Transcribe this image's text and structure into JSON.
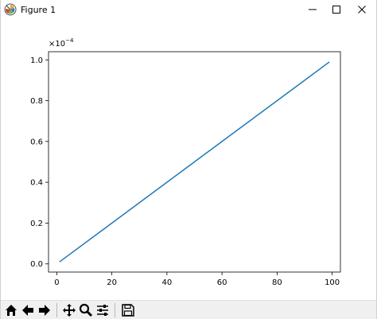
{
  "window": {
    "title": "Figure 1"
  },
  "titlebar_buttons": {
    "minimize_icon": "minimize-icon",
    "maximize_icon": "maximize-icon",
    "close_icon": "close-icon"
  },
  "toolbar": {
    "icons": [
      "home-icon",
      "back-arrow-icon",
      "forward-arrow-icon",
      "pan-icon",
      "zoom-icon",
      "configure-subplots-icon",
      "save-icon"
    ]
  },
  "colors": {
    "line": "#1f77b4",
    "toolbar_bg": "#f0f0f0"
  },
  "chart_data": {
    "type": "line",
    "x": [
      1,
      99
    ],
    "y": [
      0.01,
      0.99
    ],
    "y_offset_label_base": "×10",
    "y_offset_label_exp": "−4",
    "xlim": [
      -3,
      103
    ],
    "ylim": [
      -0.04,
      1.04
    ],
    "xticks": [
      "0",
      "20",
      "40",
      "60",
      "80",
      "100"
    ],
    "xtick_values": [
      0,
      20,
      40,
      60,
      80,
      100
    ],
    "yticks": [
      "0.0",
      "0.2",
      "0.4",
      "0.6",
      "0.8",
      "1.0"
    ],
    "ytick_values": [
      0.0,
      0.2,
      0.4,
      0.6,
      0.8,
      1.0
    ],
    "grid": false
  }
}
